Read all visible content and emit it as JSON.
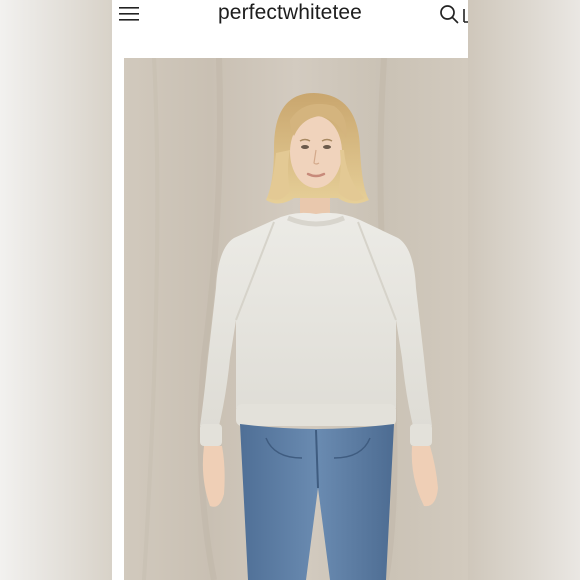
{
  "header": {
    "brand": "perfectwhitetee",
    "menu_icon": "hamburger-menu-icon",
    "search_icon": "search-icon",
    "cart_icon": "shopping-bag-icon"
  },
  "product_image": {
    "subject": "product-photo-model-wearing-sweatshirt"
  },
  "colors": {
    "background": "#ffffff",
    "backdrop": "#cfc7bb",
    "sweater": "#e8e6df",
    "jeans": "#5b7ba0",
    "brand_text": "#1d1d1d"
  }
}
